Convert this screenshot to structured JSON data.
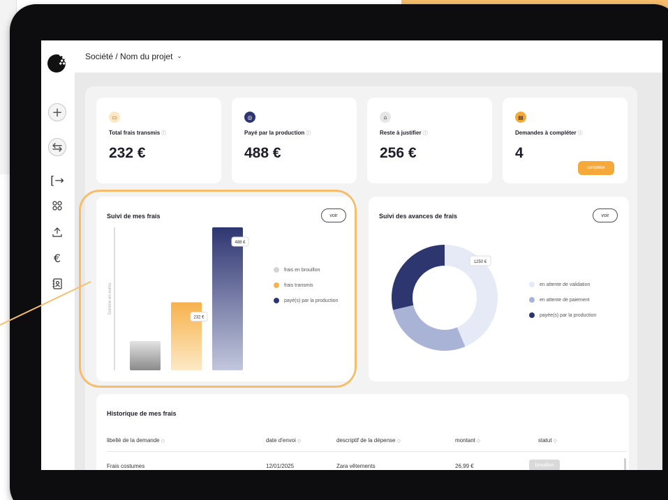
{
  "header": {
    "breadcrumb": "Société / Nom du projet"
  },
  "sidebar": {
    "icons": [
      "plus-icon",
      "swap-icon",
      "logout-icon",
      "grid-icon",
      "upload-icon",
      "euro-icon",
      "contacts-icon"
    ]
  },
  "kpis": [
    {
      "label": "Total frais transmis",
      "value": "232 €",
      "icon": "ticket-icon",
      "icon_color": "#fde7c5"
    },
    {
      "label": "Payé par la production",
      "value": "488 €",
      "icon": "coins-icon",
      "icon_color": "#2e3670"
    },
    {
      "label": "Reste à justifier",
      "value": "256 €",
      "icon": "bank-icon",
      "icon_color": "#e6e6e6"
    },
    {
      "label": "Demandes à compléter",
      "value": "4",
      "icon": "message-icon",
      "icon_color": "#f5a93a",
      "button": "compléter"
    }
  ],
  "info_glyph": "ⓘ",
  "bar_card": {
    "title": "Suivi de mes frais",
    "voir": "voir",
    "legend": [
      "frais en brouillon",
      "frais transmis",
      "payé(s) par la production"
    ]
  },
  "donut_card": {
    "title": "Suivi des avances de frais",
    "voir": "voir",
    "legend": [
      "en attente de validation",
      "en attente de paiement",
      "payée(s) par la production"
    ]
  },
  "chart_data": [
    {
      "type": "bar",
      "title": "Suivi de mes frais",
      "ylabel": "Somme en euros",
      "categories": [
        "frais en brouillon",
        "frais transmis",
        "payé(s) par la production"
      ],
      "values": [
        100,
        232,
        488
      ],
      "labels": [
        "",
        "232 €",
        "488 €"
      ],
      "ylim": [
        0,
        488
      ],
      "colors": [
        "#9a9a9a",
        "#f6b24c",
        "#2e3670"
      ]
    },
    {
      "type": "pie",
      "title": "Suivi des avances de frais",
      "categories": [
        "en attente de validation",
        "en attente de paiement",
        "payée(s) par la production"
      ],
      "values": [
        1250,
        791,
        822
      ],
      "labels": [
        "1250 €",
        "",
        ""
      ],
      "colors": [
        "#e6e9f6",
        "#a9b3d6",
        "#2e3670"
      ]
    }
  ],
  "history": {
    "title": "Historique de mes frais",
    "sort_glyph": "◇",
    "columns": [
      "libellé de la demande",
      "date d'envoi",
      "descriptif de la dépense",
      "montant",
      "statut"
    ],
    "rows": [
      {
        "label": "Frais costumes",
        "date": "12/01/2025",
        "description": "Zara vêtements",
        "amount": "26,99 €",
        "status": "brouillon"
      }
    ]
  }
}
